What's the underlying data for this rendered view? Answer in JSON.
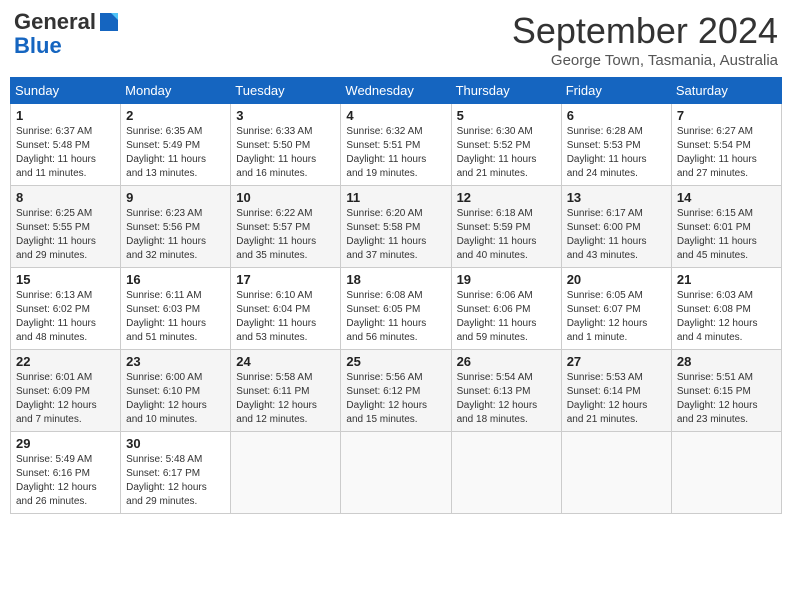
{
  "header": {
    "logo_general": "General",
    "logo_blue": "Blue",
    "month": "September 2024",
    "location": "George Town, Tasmania, Australia"
  },
  "weekdays": [
    "Sunday",
    "Monday",
    "Tuesday",
    "Wednesday",
    "Thursday",
    "Friday",
    "Saturday"
  ],
  "weeks": [
    [
      {
        "day": "1",
        "info": "Sunrise: 6:37 AM\nSunset: 5:48 PM\nDaylight: 11 hours\nand 11 minutes."
      },
      {
        "day": "2",
        "info": "Sunrise: 6:35 AM\nSunset: 5:49 PM\nDaylight: 11 hours\nand 13 minutes."
      },
      {
        "day": "3",
        "info": "Sunrise: 6:33 AM\nSunset: 5:50 PM\nDaylight: 11 hours\nand 16 minutes."
      },
      {
        "day": "4",
        "info": "Sunrise: 6:32 AM\nSunset: 5:51 PM\nDaylight: 11 hours\nand 19 minutes."
      },
      {
        "day": "5",
        "info": "Sunrise: 6:30 AM\nSunset: 5:52 PM\nDaylight: 11 hours\nand 21 minutes."
      },
      {
        "day": "6",
        "info": "Sunrise: 6:28 AM\nSunset: 5:53 PM\nDaylight: 11 hours\nand 24 minutes."
      },
      {
        "day": "7",
        "info": "Sunrise: 6:27 AM\nSunset: 5:54 PM\nDaylight: 11 hours\nand 27 minutes."
      }
    ],
    [
      {
        "day": "8",
        "info": "Sunrise: 6:25 AM\nSunset: 5:55 PM\nDaylight: 11 hours\nand 29 minutes."
      },
      {
        "day": "9",
        "info": "Sunrise: 6:23 AM\nSunset: 5:56 PM\nDaylight: 11 hours\nand 32 minutes."
      },
      {
        "day": "10",
        "info": "Sunrise: 6:22 AM\nSunset: 5:57 PM\nDaylight: 11 hours\nand 35 minutes."
      },
      {
        "day": "11",
        "info": "Sunrise: 6:20 AM\nSunset: 5:58 PM\nDaylight: 11 hours\nand 37 minutes."
      },
      {
        "day": "12",
        "info": "Sunrise: 6:18 AM\nSunset: 5:59 PM\nDaylight: 11 hours\nand 40 minutes."
      },
      {
        "day": "13",
        "info": "Sunrise: 6:17 AM\nSunset: 6:00 PM\nDaylight: 11 hours\nand 43 minutes."
      },
      {
        "day": "14",
        "info": "Sunrise: 6:15 AM\nSunset: 6:01 PM\nDaylight: 11 hours\nand 45 minutes."
      }
    ],
    [
      {
        "day": "15",
        "info": "Sunrise: 6:13 AM\nSunset: 6:02 PM\nDaylight: 11 hours\nand 48 minutes."
      },
      {
        "day": "16",
        "info": "Sunrise: 6:11 AM\nSunset: 6:03 PM\nDaylight: 11 hours\nand 51 minutes."
      },
      {
        "day": "17",
        "info": "Sunrise: 6:10 AM\nSunset: 6:04 PM\nDaylight: 11 hours\nand 53 minutes."
      },
      {
        "day": "18",
        "info": "Sunrise: 6:08 AM\nSunset: 6:05 PM\nDaylight: 11 hours\nand 56 minutes."
      },
      {
        "day": "19",
        "info": "Sunrise: 6:06 AM\nSunset: 6:06 PM\nDaylight: 11 hours\nand 59 minutes."
      },
      {
        "day": "20",
        "info": "Sunrise: 6:05 AM\nSunset: 6:07 PM\nDaylight: 12 hours\nand 1 minute."
      },
      {
        "day": "21",
        "info": "Sunrise: 6:03 AM\nSunset: 6:08 PM\nDaylight: 12 hours\nand 4 minutes."
      }
    ],
    [
      {
        "day": "22",
        "info": "Sunrise: 6:01 AM\nSunset: 6:09 PM\nDaylight: 12 hours\nand 7 minutes."
      },
      {
        "day": "23",
        "info": "Sunrise: 6:00 AM\nSunset: 6:10 PM\nDaylight: 12 hours\nand 10 minutes."
      },
      {
        "day": "24",
        "info": "Sunrise: 5:58 AM\nSunset: 6:11 PM\nDaylight: 12 hours\nand 12 minutes."
      },
      {
        "day": "25",
        "info": "Sunrise: 5:56 AM\nSunset: 6:12 PM\nDaylight: 12 hours\nand 15 minutes."
      },
      {
        "day": "26",
        "info": "Sunrise: 5:54 AM\nSunset: 6:13 PM\nDaylight: 12 hours\nand 18 minutes."
      },
      {
        "day": "27",
        "info": "Sunrise: 5:53 AM\nSunset: 6:14 PM\nDaylight: 12 hours\nand 21 minutes."
      },
      {
        "day": "28",
        "info": "Sunrise: 5:51 AM\nSunset: 6:15 PM\nDaylight: 12 hours\nand 23 minutes."
      }
    ],
    [
      {
        "day": "29",
        "info": "Sunrise: 5:49 AM\nSunset: 6:16 PM\nDaylight: 12 hours\nand 26 minutes."
      },
      {
        "day": "30",
        "info": "Sunrise: 5:48 AM\nSunset: 6:17 PM\nDaylight: 12 hours\nand 29 minutes."
      },
      {
        "day": "",
        "info": ""
      },
      {
        "day": "",
        "info": ""
      },
      {
        "day": "",
        "info": ""
      },
      {
        "day": "",
        "info": ""
      },
      {
        "day": "",
        "info": ""
      }
    ]
  ]
}
